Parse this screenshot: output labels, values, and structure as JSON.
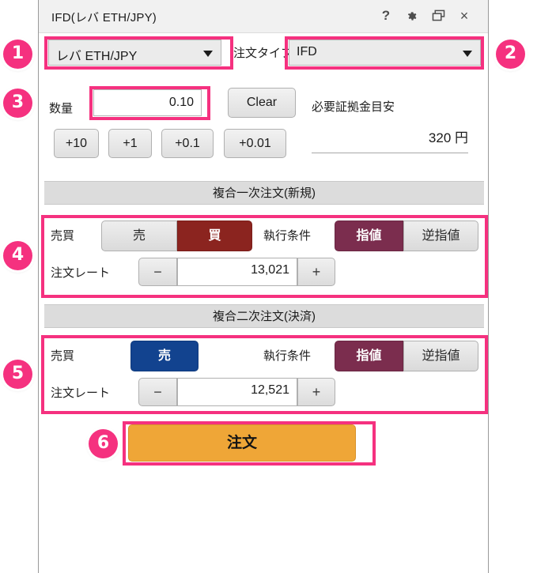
{
  "window": {
    "title": "IFD(レバ ETH/JPY)",
    "titlebar_icons": [
      {
        "name": "help-icon",
        "glyph": "?"
      },
      {
        "name": "gear-icon",
        "glyph": "gear"
      },
      {
        "name": "restore-icon",
        "glyph": "restore"
      },
      {
        "name": "close-icon",
        "glyph": "×"
      }
    ]
  },
  "pair_select": {
    "value": "レバ ETH/JPY",
    "arrow": "▼"
  },
  "order_type": {
    "label": "注文タイプ",
    "value": "IFD",
    "arrow": "▼"
  },
  "quantity": {
    "label": "数量",
    "value": "0.10",
    "clear_label": "Clear",
    "steps": [
      "+10",
      "+1",
      "+0.1",
      "+0.01"
    ]
  },
  "margin": {
    "label": "必要証拠金目安",
    "value": "320 円"
  },
  "primary_order": {
    "header": "複合一次注文(新規)",
    "side_label": "売買",
    "side_sell_label": "売",
    "side_buy_label": "買",
    "condition_label": "執行条件",
    "condition_limit_label": "指値",
    "condition_stop_label": "逆指値",
    "rate_label": "注文レート",
    "rate_value": "13,021",
    "minus_label": "−",
    "plus_label": "+"
  },
  "secondary_order": {
    "header": "複合二次注文(決済)",
    "side_label": "売買",
    "side_sell_label": "売",
    "condition_label": "執行条件",
    "condition_limit_label": "指値",
    "condition_stop_label": "逆指値",
    "rate_label": "注文レート",
    "rate_value": "12,521",
    "minus_label": "−",
    "plus_label": "+"
  },
  "submit": {
    "label": "注文"
  },
  "annotations": {
    "steps": [
      "①",
      "②",
      "③",
      "④",
      "⑤",
      "⑥"
    ],
    "numbers": [
      "1",
      "2",
      "3",
      "4",
      "5",
      "6"
    ]
  },
  "colors": {
    "highlight": "#f5317f",
    "buy": "#8b241f",
    "sell": "#12438f",
    "condition_active": "#7b2d4e",
    "submit": "#efa637"
  }
}
